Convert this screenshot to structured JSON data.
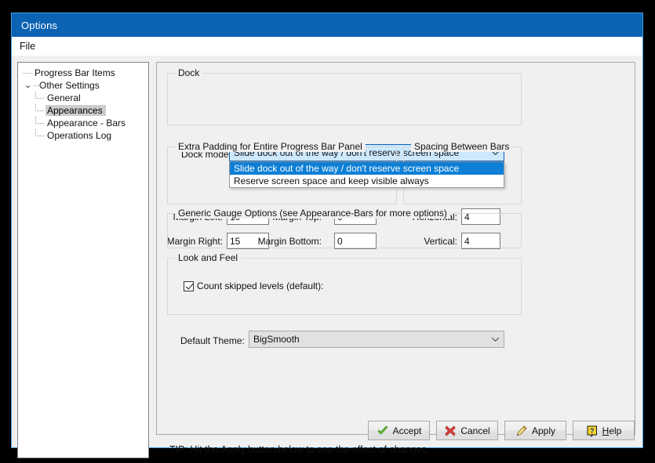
{
  "window": {
    "title": "Options",
    "menu": [
      "File"
    ]
  },
  "tree": {
    "items": [
      {
        "label": "Progress Bar Items",
        "level": 0,
        "expander": "none",
        "selected": false
      },
      {
        "label": "Other Settings",
        "level": 0,
        "expander": "expanded",
        "selected": false
      },
      {
        "label": "General",
        "level": 1,
        "expander": "none",
        "selected": false
      },
      {
        "label": "Appearances",
        "level": 1,
        "expander": "none",
        "selected": true
      },
      {
        "label": "Appearance - Bars",
        "level": 1,
        "expander": "none",
        "selected": false
      },
      {
        "label": "Operations Log",
        "level": 1,
        "expander": "none",
        "selected": false
      }
    ]
  },
  "dock": {
    "group_title": "Dock",
    "mode_label": "Dock mode:",
    "mode_value": "Slide dock out of the way / don't reserve screen space",
    "options": [
      "Slide dock out of the way / don't reserve screen space",
      "Reserve screen space and keep visible always"
    ],
    "selected_index": 0,
    "expanded": true
  },
  "padding": {
    "group_title": "Extra Padding for Entire Progress Bar Panel",
    "margin_left_label": "Margin Left:",
    "margin_left_value": "10",
    "margin_top_label": "Margin Top:",
    "margin_top_value": "0",
    "margin_right_label": "Margin Right:",
    "margin_right_value": "15",
    "margin_bottom_label": "Margin Bottom:",
    "margin_bottom_value": "0"
  },
  "spacing": {
    "group_title": "Spacing Between Bars",
    "horizontal_label": "Horizontal:",
    "horizontal_value": "4",
    "vertical_label": "Vertical:",
    "vertical_value": "4"
  },
  "gauge": {
    "group_title": "Generic Gauge Options (see Appearance-Bars for more options)",
    "count_skipped_label": "Count skipped levels (default):",
    "count_skipped_checked": true
  },
  "look_and_feel": {
    "group_title": "Look and Feel",
    "theme_label": "Default Theme:",
    "theme_value": "BigSmooth"
  },
  "tip": "TIP: Hit the Apply button below to see the effect of changes.",
  "buttons": {
    "accept": "Accept",
    "cancel": "Cancel",
    "apply": "Apply",
    "help_underlined": "H",
    "help_rest": "elp"
  },
  "colors": {
    "titlebar": "#0c62b3",
    "highlight": "#0d7fd6",
    "combo_focus_bg": "#cce8ff",
    "window_border": "#3f9ee5",
    "face": "#f0f0f0",
    "accept_icon": "#62c031",
    "cancel_icon": "#d6403a",
    "help_icon": "#f5d32b"
  }
}
